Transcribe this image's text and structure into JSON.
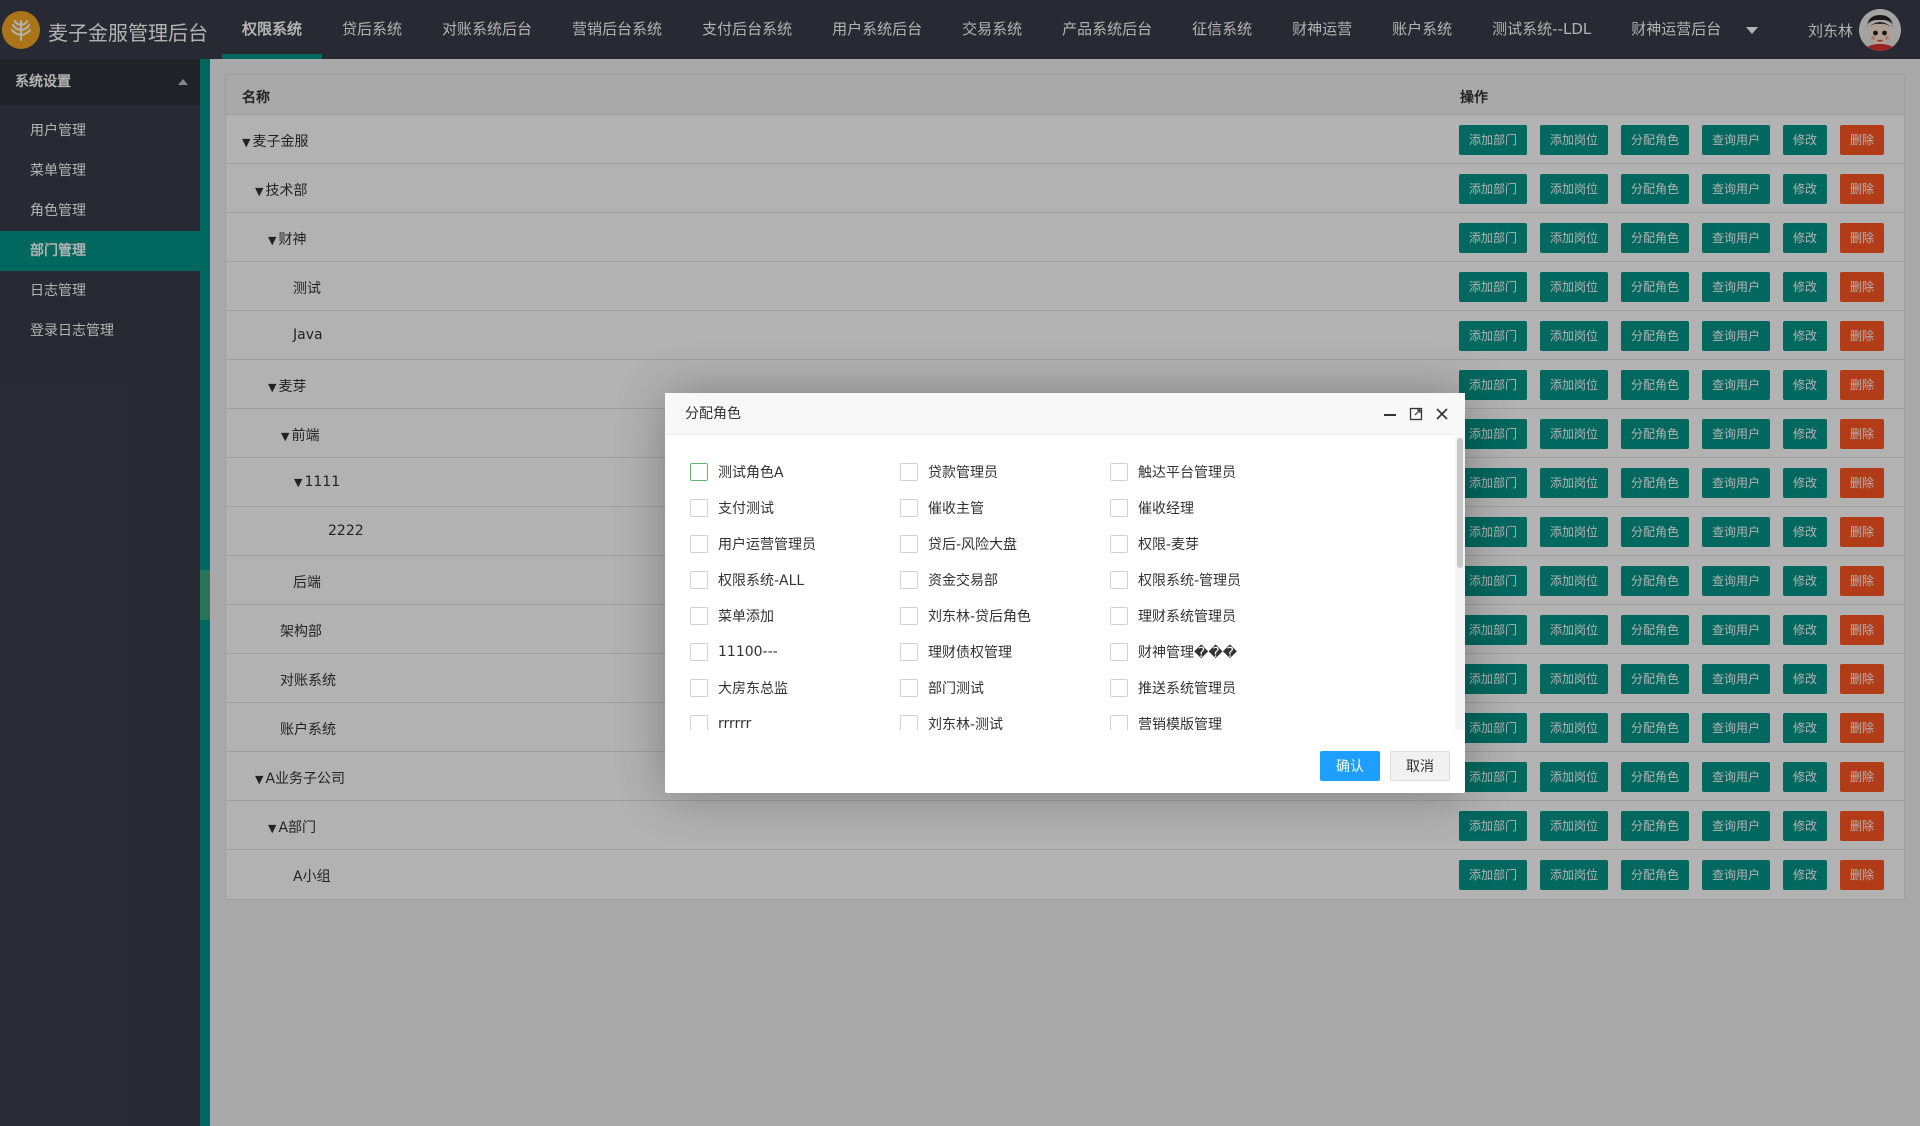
{
  "header": {
    "app_title": "麦子金服管理后台",
    "nav": [
      "权限系统",
      "贷后系统",
      "对账系统后台",
      "营销后台系统",
      "支付后台系统",
      "用户系统后台",
      "交易系统",
      "产品系统后台",
      "征信系统",
      "财神运营",
      "账户系统",
      "测试系统--LDL",
      "财神运营后台"
    ],
    "active_nav": "权限系统",
    "user_name": "刘东林"
  },
  "sidebar": {
    "title": "系统设置",
    "items": [
      "用户管理",
      "菜单管理",
      "角色管理",
      "部门管理",
      "日志管理",
      "登录日志管理"
    ],
    "active": "部门管理"
  },
  "table": {
    "header_name": "名称",
    "header_ops": "操作",
    "ops": [
      "添加部门",
      "添加岗位",
      "分配角色",
      "查询用户",
      "修改",
      "删除"
    ],
    "rows": [
      {
        "name": "麦子金服",
        "expanded": true,
        "level": 0
      },
      {
        "name": "技术部",
        "expanded": true,
        "level": 1
      },
      {
        "name": "财神",
        "expanded": true,
        "level": 2
      },
      {
        "name": "测试",
        "expanded": false,
        "level": 3
      },
      {
        "name": "Java",
        "expanded": false,
        "level": 3
      },
      {
        "name": "麦芽",
        "expanded": true,
        "level": 2
      },
      {
        "name": "前端",
        "expanded": true,
        "level": 3
      },
      {
        "name": "1111",
        "expanded": true,
        "level": 4
      },
      {
        "name": "2222",
        "expanded": false,
        "level": 5
      },
      {
        "name": "后端",
        "expanded": false,
        "level": 3
      },
      {
        "name": "架构部",
        "expanded": false,
        "level": 2
      },
      {
        "name": "对账系统",
        "expanded": false,
        "level": 2
      },
      {
        "name": "账户系统",
        "expanded": false,
        "level": 2
      },
      {
        "name": "A业务子公司",
        "expanded": true,
        "level": 1
      },
      {
        "name": "A部门",
        "expanded": true,
        "level": 2
      },
      {
        "name": "A小组",
        "expanded": false,
        "level": 3
      }
    ]
  },
  "modal": {
    "title": "分配角色",
    "roles": [
      "测试角色A",
      "贷款管理员",
      "触达平台管理员",
      "支付测试",
      "催收主管",
      "催收经理",
      "用户运营管理员",
      "贷后-风险大盘",
      "权限-麦芽",
      "权限系统-ALL",
      "资金交易部",
      "权限系统-管理员",
      "菜单添加",
      "刘东林-贷后角色",
      "理财系统管理员",
      "11100---",
      "理财债权管理",
      "财神管理���",
      "大房东总监",
      "部门测试",
      "推送系统管理员",
      "rrrrrr",
      "刘东林-测试",
      "营销模版管理"
    ],
    "confirm": "确认",
    "cancel": "取消"
  },
  "colors": {
    "header_bg": "#393d49",
    "accent": "#009688",
    "danger": "#ff5722",
    "primary": "#1e9fff"
  }
}
